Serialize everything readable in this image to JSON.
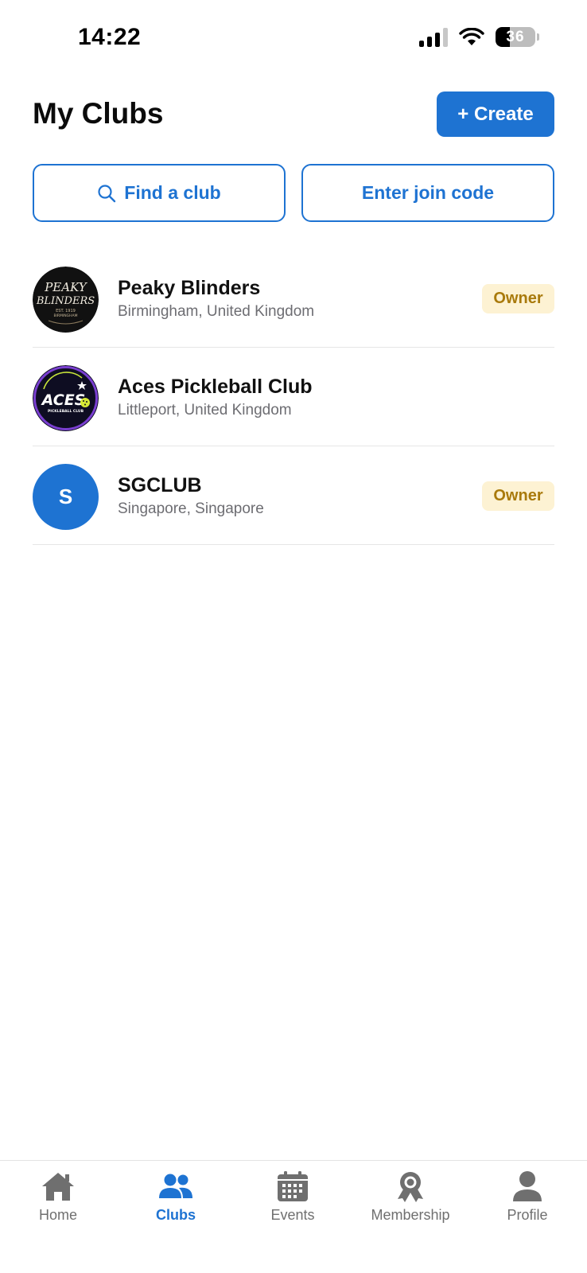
{
  "status_bar": {
    "time": "14:22",
    "battery": "36",
    "battery_level": 0.36
  },
  "header": {
    "title": "My Clubs",
    "create_label": "+ Create"
  },
  "actions": {
    "find_club_label": "Find a club",
    "join_code_label": "Enter join code"
  },
  "clubs": [
    {
      "name": "Peaky Blinders",
      "location": "Birmingham, United Kingdom",
      "role": "Owner",
      "logo_text": [
        "PEAKY",
        "BLINDERS"
      ],
      "logo_sub": "EST. 1919",
      "logo_sub2": "BIRMINGHAM"
    },
    {
      "name": "Aces Pickleball Club",
      "location": "Littleport, United Kingdom",
      "role": "",
      "logo_text": "ACES",
      "logo_sub": "PICKLEBALL CLUB"
    },
    {
      "name": "SGCLUB",
      "location": "Singapore, Singapore",
      "role": "Owner",
      "initial": "S"
    }
  ],
  "tabs": [
    {
      "label": "Home",
      "icon": "home-icon"
    },
    {
      "label": "Clubs",
      "icon": "clubs-icon",
      "active": true
    },
    {
      "label": "Events",
      "icon": "calendar-icon"
    },
    {
      "label": "Membership",
      "icon": "membership-badge-icon"
    },
    {
      "label": "Profile",
      "icon": "profile-icon"
    }
  ],
  "colors": {
    "accent": "#1e73d2",
    "badge_bg": "#fdf2d3",
    "badge_text": "#a97a0c",
    "secondary_text": "#6d6d72",
    "tab_inactive": "#6f6f6f"
  }
}
